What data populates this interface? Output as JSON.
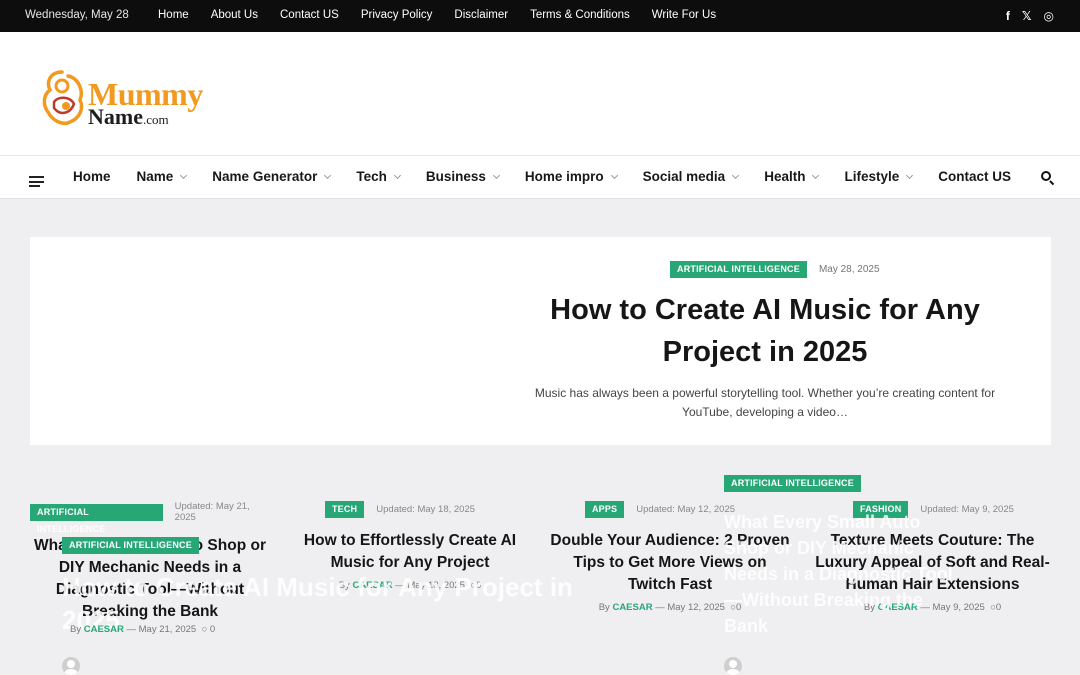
{
  "topbar": {
    "date": "Wednesday, May 28",
    "links": [
      "Home",
      "About Us",
      "Contact US",
      "Privacy Policy",
      "Disclaimer",
      "Terms & Conditions",
      "Write For Us"
    ],
    "social": [
      "f",
      "𝕏",
      "◎"
    ]
  },
  "logo": {
    "word1": "Mummy",
    "word2": "Name",
    "word3": ".com"
  },
  "nav": {
    "items": [
      {
        "label": "Home",
        "dropdown": false
      },
      {
        "label": "Name",
        "dropdown": true
      },
      {
        "label": "Name Generator",
        "dropdown": true
      },
      {
        "label": "Tech",
        "dropdown": true
      },
      {
        "label": "Business",
        "dropdown": true
      },
      {
        "label": "Home impro",
        "dropdown": true
      },
      {
        "label": "Social media",
        "dropdown": true
      },
      {
        "label": "Health",
        "dropdown": true
      },
      {
        "label": "Lifestyle",
        "dropdown": true
      },
      {
        "label": "Contact US",
        "dropdown": false
      }
    ]
  },
  "featured": {
    "category": "ARTIFICIAL INTELLIGENCE",
    "date": "May 28, 2025",
    "title": "How to Create AI Music for Any Project in 2025",
    "excerpt": "Music has always been a powerful storytelling tool. Whether you’re creating content for YouTube, developing a video…"
  },
  "cards": [
    {
      "category": "ARTIFICIAL INTELLIGENCE",
      "updated": "Updated:",
      "date": "May 21, 2025",
      "title": "What Every Small Auto Shop or DIY Mechanic Needs in a Diagnostic Tool—Without Breaking the Bank"
    },
    {
      "category": "TECH",
      "updated": "Updated:",
      "date": "May 18, 2025",
      "title": "How to Effortlessly Create AI Music for Any Project",
      "by": "By",
      "author": "CAESAR",
      "bydate": "May 18, 2025",
      "comments": "0"
    },
    {
      "category": "APPS",
      "updated": "Updated:",
      "date": "May 12, 2025",
      "title": "Double Your Audience: 2 Proven Tips to Get More Views on Twitch Fast",
      "by": "By",
      "author": "CAESAR",
      "bydate": "May 12, 2025",
      "comments": "0"
    },
    {
      "category": "FASHION",
      "updated": "Updated:",
      "date": "May 9, 2025",
      "title": "Texture Meets Couture: The Luxury Appeal of Soft and Real-Human Hair Extensions",
      "by": "By",
      "author": "CAESAR",
      "bydate": "May 9, 2025",
      "comments": "0"
    }
  ],
  "overlay": {
    "left": {
      "category": "ARTIFICIAL INTELLIGENCE",
      "title": "How to Create AI Music for Any Project in 2025",
      "by": "By",
      "author": "CAESAR",
      "date": "May 21, 2025",
      "comments": "0"
    },
    "right": {
      "category": "ARTIFICIAL INTELLIGENCE",
      "title": "What Every Small Auto Shop or DIY Mechanic Needs in a Diagnostic Tool—Without Breaking the Bank"
    }
  },
  "colors": {
    "accent": "#27a776",
    "logo_orange": "#f29a1f",
    "topbar": "#0d0d0d"
  }
}
